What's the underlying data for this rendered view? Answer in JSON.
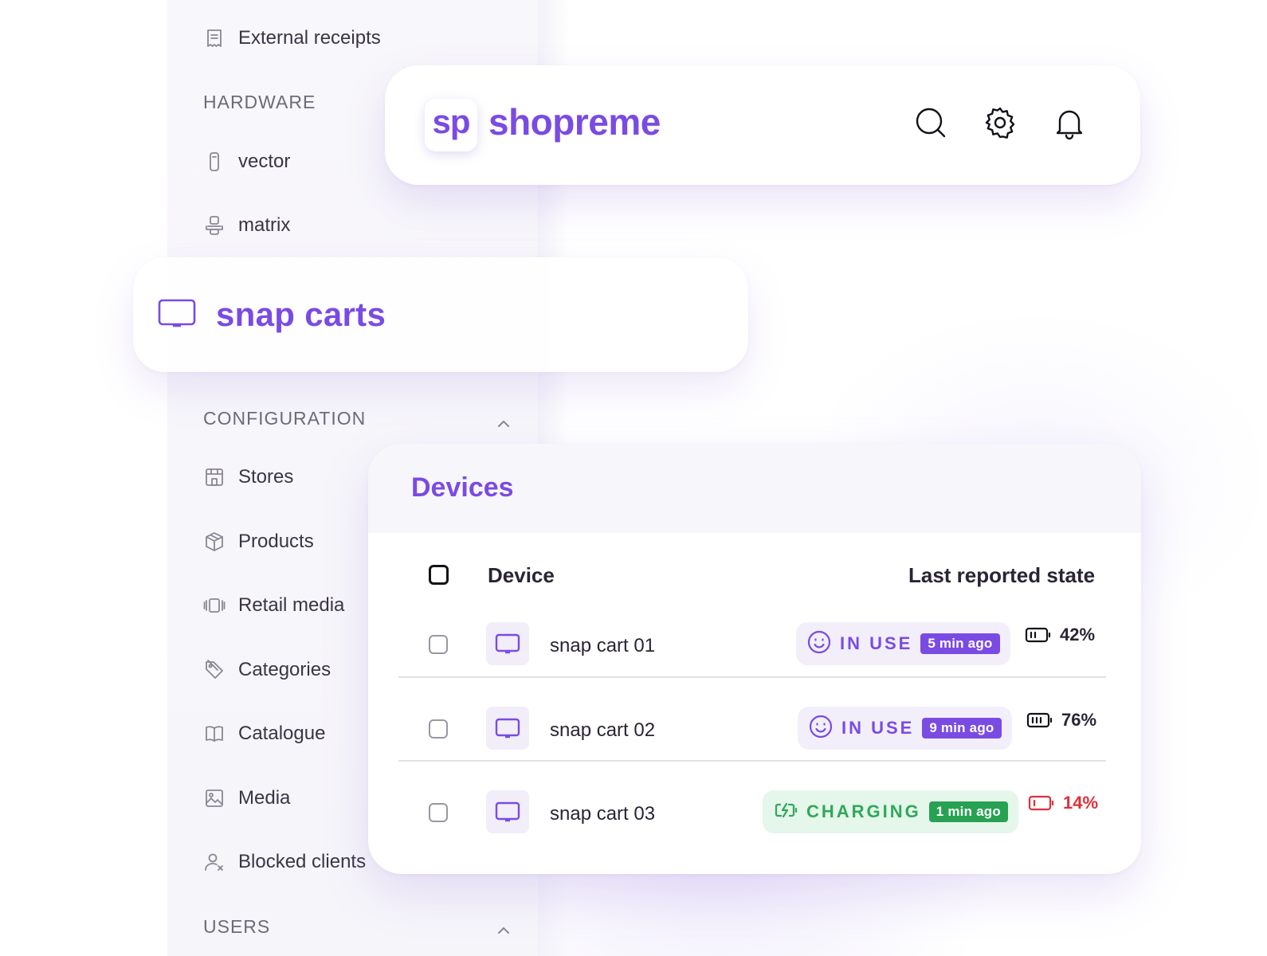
{
  "sidebar": {
    "external_receipts": "External receipts",
    "hardware_label": "HARDWARE",
    "vector": "vector",
    "matrix": "matrix",
    "configuration_label": "CONFIGURATION",
    "stores": "Stores",
    "products": "Products",
    "retail_media": "Retail media",
    "categories": "Categories",
    "catalogue": "Catalogue",
    "media": "Media",
    "blocked_clients": "Blocked clients",
    "users_label": "USERS"
  },
  "header": {
    "logo_mark": "sp",
    "brand": "shopreme"
  },
  "selected_nav": {
    "label": "snap carts"
  },
  "devices": {
    "title": "Devices",
    "col_device": "Device",
    "col_state": "Last reported state",
    "rows": [
      {
        "name": "snap cart 01",
        "status": "IN USE",
        "time": "5 min ago",
        "battery": "42%",
        "battery_level": 0.42
      },
      {
        "name": "snap cart 02",
        "status": "IN USE",
        "time": "9 min ago",
        "battery": "76%",
        "battery_level": 0.76
      },
      {
        "name": "snap cart 03",
        "status": "CHARGING",
        "time": "1 min ago",
        "battery": "14%",
        "battery_level": 0.14
      }
    ]
  },
  "colors": {
    "brand_purple": "#7a4be3",
    "charging_green": "#2fa85a",
    "battery_low_red": "#e02f3a"
  }
}
